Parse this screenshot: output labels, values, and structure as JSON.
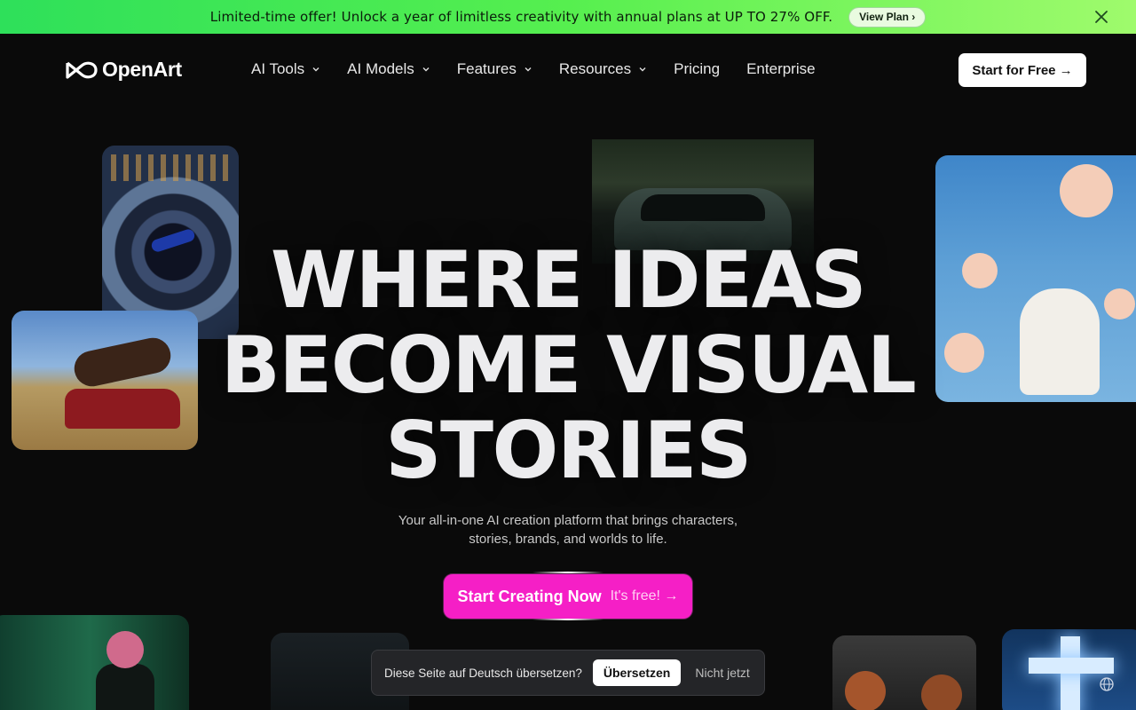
{
  "promo": {
    "text": "Limited-time offer! Unlock a year of limitless creativity with annual plans at UP TO 27% OFF.",
    "button": "View Plan ›",
    "close_icon": "close-icon"
  },
  "nav": {
    "logo": "OpenArt",
    "items": [
      {
        "label": "AI Tools",
        "dropdown": true
      },
      {
        "label": "AI Models",
        "dropdown": true
      },
      {
        "label": "Features",
        "dropdown": true
      },
      {
        "label": "Resources",
        "dropdown": true
      },
      {
        "label": "Pricing",
        "dropdown": false
      },
      {
        "label": "Enterprise",
        "dropdown": false
      }
    ],
    "cta": "Start for Free →"
  },
  "hero": {
    "line1": "WHERE IDEAS",
    "line2": "BECOME VISUAL",
    "line3": "STORIES",
    "subtitle": "Your all-in-one AI creation platform that brings characters, stories, brands, and worlds to life.",
    "cta_strong": "Start Creating Now",
    "cta_light": "It's free! →"
  },
  "translate_bar": {
    "text": "Diese Seite auf Deutsch übersetzen?",
    "translate_button": "Übersetzen",
    "dismiss": "Nicht jetzt"
  },
  "colors": {
    "accent": "#f51fc6",
    "promo_start": "#2ee05a",
    "promo_end": "#9ffb6c",
    "background": "#0a0a0a"
  }
}
